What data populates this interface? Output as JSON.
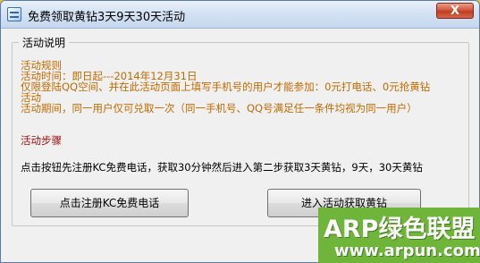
{
  "window": {
    "title": "免费领取黄钻3天9天30天活动",
    "close_label": "X"
  },
  "group": {
    "legend": "活动说明"
  },
  "rules": {
    "heading": "活动规则",
    "time": "活动时间：即日起---2014年12月31日",
    "eligibility_line1": "仅限登陆QQ空间、并在此活动页面上填写手机号的用户才能参加：0元打电话、0元抢黄钻",
    "eligibility_line2": "活动",
    "period": "活动期间，同一用户仅可兑取一次（同一手机号、QQ号满足任一条件均视为同一用户）"
  },
  "steps": {
    "heading": "活动步骤",
    "instruction": "点击按钮先注册KC免费电话，获取30分钟然后进入第二步获取3天黄钻，9天，30天黄钻"
  },
  "buttons": {
    "register": "点击注册KC免费电话",
    "enter": "进入活动获取黄钻"
  },
  "watermark": {
    "brand": "ARP绿色联盟",
    "url": "www.arpun.com"
  }
}
